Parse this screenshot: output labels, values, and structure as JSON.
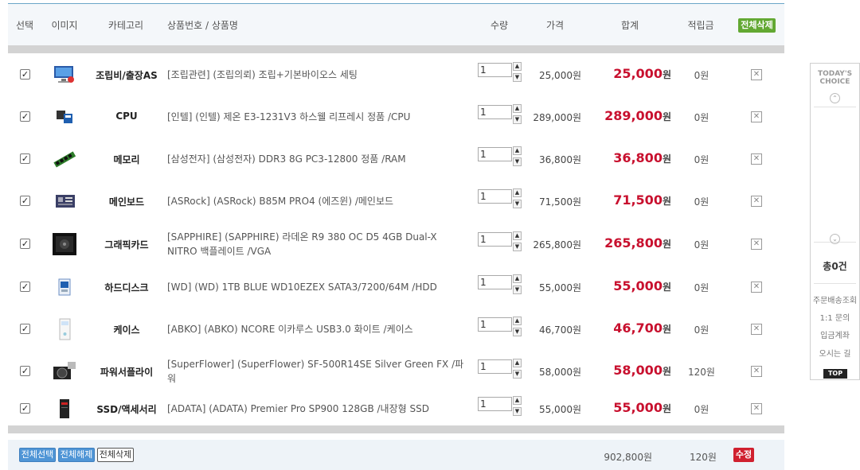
{
  "header": {
    "select": "선택",
    "image": "이미지",
    "category": "카테고리",
    "product": "상품번호 / 상품명",
    "quantity": "수량",
    "price": "가격",
    "total": "합계",
    "points": "적립금",
    "delete_all": "전체삭제"
  },
  "rows": [
    {
      "checked": true,
      "image_icon": "service-icon",
      "category": "조립비/출장AS",
      "name": "[조립관련] (조립의뢰) 조립+기본바이오스 세팅",
      "qty": "1",
      "price": "25,000원",
      "total": "25,000",
      "points": "0원"
    },
    {
      "checked": true,
      "image_icon": "cpu-icon",
      "category": "CPU",
      "name": "[인텔] (인텔) 제온 E3-1231V3 하스웰 리프레시 정품 /CPU",
      "qty": "1",
      "price": "289,000원",
      "total": "289,000",
      "points": "0원"
    },
    {
      "checked": true,
      "image_icon": "ram-icon",
      "category": "메모리",
      "name": "[삼성전자] (삼성전자) DDR3 8G PC3-12800 정품 /RAM",
      "qty": "1",
      "price": "36,800원",
      "total": "36,800",
      "points": "0원"
    },
    {
      "checked": true,
      "image_icon": "motherboard-icon",
      "category": "메인보드",
      "name": "[ASRock] (ASRock) B85M PRO4 (에즈윈) /메인보드",
      "qty": "1",
      "price": "71,500원",
      "total": "71,500",
      "points": "0원"
    },
    {
      "checked": true,
      "image_icon": "graphics-card-icon",
      "category": "그래픽카드",
      "name": "[SAPPHIRE] (SAPPHIRE) 라데온 R9 380 OC D5 4GB Dual-X NITRO 백플레이트 /VGA",
      "qty": "1",
      "price": "265,800원",
      "total": "265,800",
      "points": "0원"
    },
    {
      "checked": true,
      "image_icon": "hdd-icon",
      "category": "하드디스크",
      "name": "[WD] (WD) 1TB BLUE WD10EZEX SATA3/7200/64M /HDD",
      "qty": "1",
      "price": "55,000원",
      "total": "55,000",
      "points": "0원"
    },
    {
      "checked": true,
      "image_icon": "case-icon",
      "category": "케이스",
      "name": "[ABKO] (ABKO) NCORE 이카루스 USB3.0 화이트 /케이스",
      "qty": "1",
      "price": "46,700원",
      "total": "46,700",
      "points": "0원"
    },
    {
      "checked": true,
      "image_icon": "power-supply-icon",
      "category": "파워서플라이",
      "name": "[SuperFlower] (SuperFlower) SF-500R14SE Silver Green FX /파워",
      "qty": "1",
      "price": "58,000원",
      "total": "58,000",
      "points": "120원"
    },
    {
      "checked": true,
      "image_icon": "ssd-icon",
      "category": "SSD/액세서리",
      "name": "[ADATA] (ADATA) Premier Pro SP900 128GB /내장형 SSD",
      "qty": "1",
      "price": "55,000원",
      "total": "55,000",
      "points": "0원"
    }
  ],
  "currency_unit": "원",
  "footer": {
    "select_all": "전체선택",
    "deselect_all": "전체해제",
    "delete_all": "전체삭제",
    "sum_total": "902,800원",
    "sum_points": "120원",
    "edit": "수정"
  },
  "sidebar": {
    "title_line1": "TODAY'S",
    "title_line2": "CHOICE",
    "count": "총0건",
    "links": [
      "주문배송조회",
      "1:1 문의",
      "입금계좌",
      "오시는 길"
    ],
    "top": "TOP"
  },
  "colors": {
    "accent_red": "#c8102e",
    "accent_green": "#62a832",
    "accent_blue": "#4f95d6"
  }
}
